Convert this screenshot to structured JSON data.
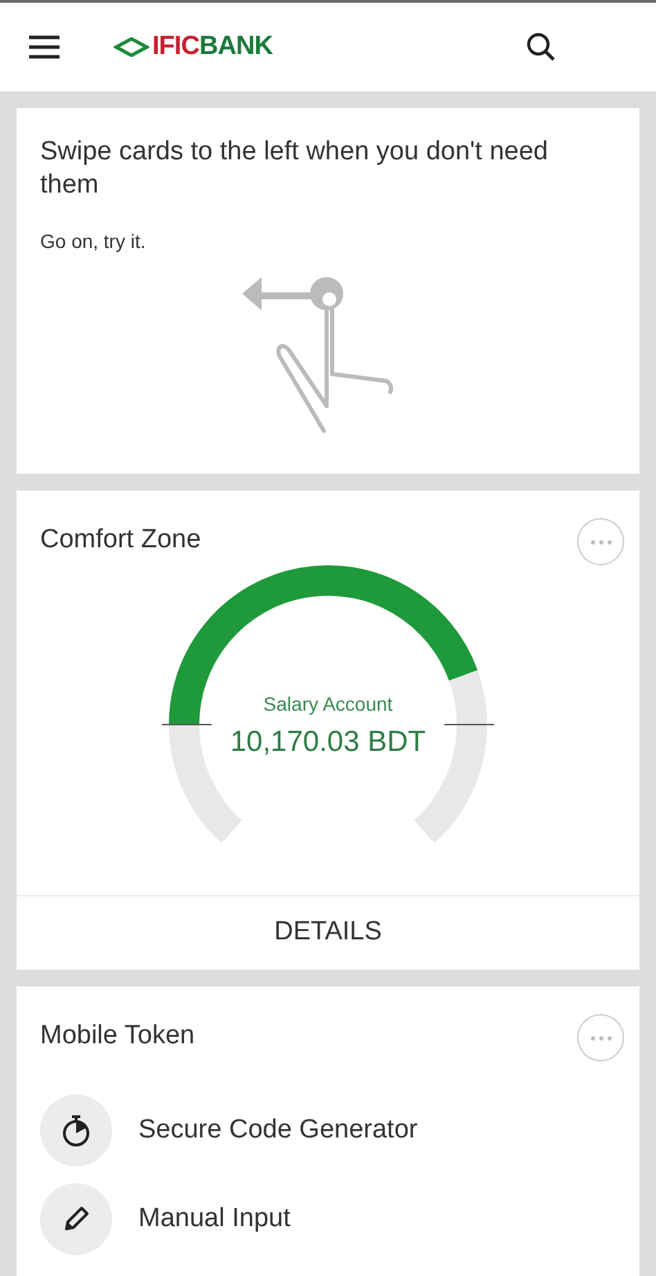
{
  "header": {
    "logo": {
      "part_1": "IFIC",
      "part_2": "BANK"
    }
  },
  "swipe_card": {
    "title": "Swipe cards to the left when you don't need them",
    "hint": "Go on, try it."
  },
  "comfort_zone": {
    "title": "Comfort Zone",
    "gauge": {
      "label": "Salary Account",
      "amount": "10,170.03 BDT"
    },
    "action": "DETAILS"
  },
  "mobile_token": {
    "title": "Mobile Token",
    "items": [
      {
        "kind": "timer",
        "label": "Secure Code Generator"
      },
      {
        "kind": "pencil",
        "label": "Manual Input"
      }
    ]
  }
}
